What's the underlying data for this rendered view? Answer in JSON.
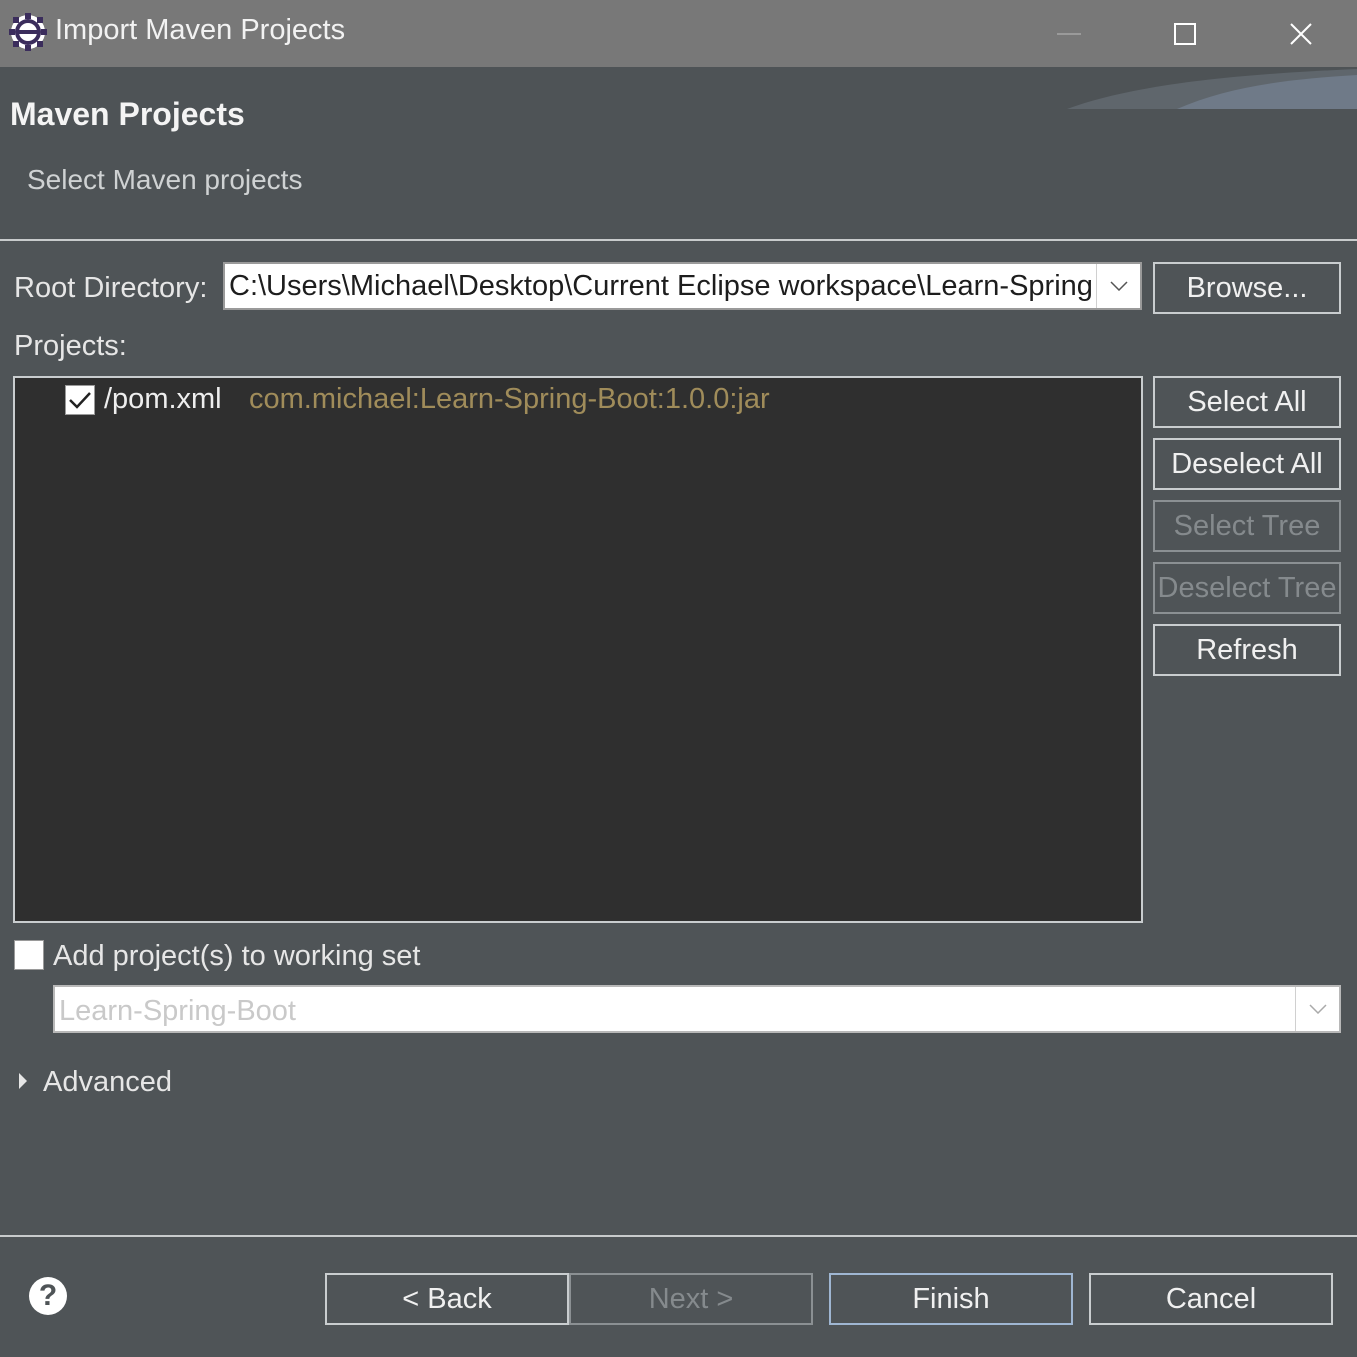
{
  "window": {
    "title": "Import Maven Projects",
    "icons": {
      "app": "eclipse-gear-icon",
      "minimize": "minimize-icon",
      "maximize": "maximize-icon",
      "close": "close-icon"
    }
  },
  "header": {
    "title": "Maven Projects",
    "subtitle": "Select Maven projects"
  },
  "root_directory": {
    "label_text": "Root Directory:",
    "value": "C:\\Users\\Michael\\Desktop\\Current Eclipse workspace\\Learn-Spring",
    "browse_button": "Browse..."
  },
  "projects": {
    "label": "Projects:",
    "items": [
      {
        "path": "/pom.xml",
        "artifact": "com.michael:Learn-Spring-Boot:1.0.0:jar",
        "checked": true
      }
    ],
    "buttons": {
      "select_all": "Select All",
      "deselect_all": "Deselect All",
      "select_tree": "Select Tree",
      "deselect_tree": "Deselect Tree",
      "refresh": "Refresh"
    }
  },
  "working_set": {
    "checkbox_label": "Add project(s) to working set",
    "checked": false,
    "value": "Learn-Spring-Boot"
  },
  "advanced": {
    "label": "Advanced",
    "expanded": false
  },
  "footer": {
    "back": "< Back",
    "next": "Next >",
    "finish": "Finish",
    "cancel": "Cancel",
    "help_icon": "help-icon"
  },
  "colors": {
    "dialog_bg": "#4f5457",
    "titlebar_bg": "#787878",
    "tree_bg": "#2f2f2f",
    "artifact_text": "#a08c5a",
    "disabled_text": "#858a8d"
  }
}
